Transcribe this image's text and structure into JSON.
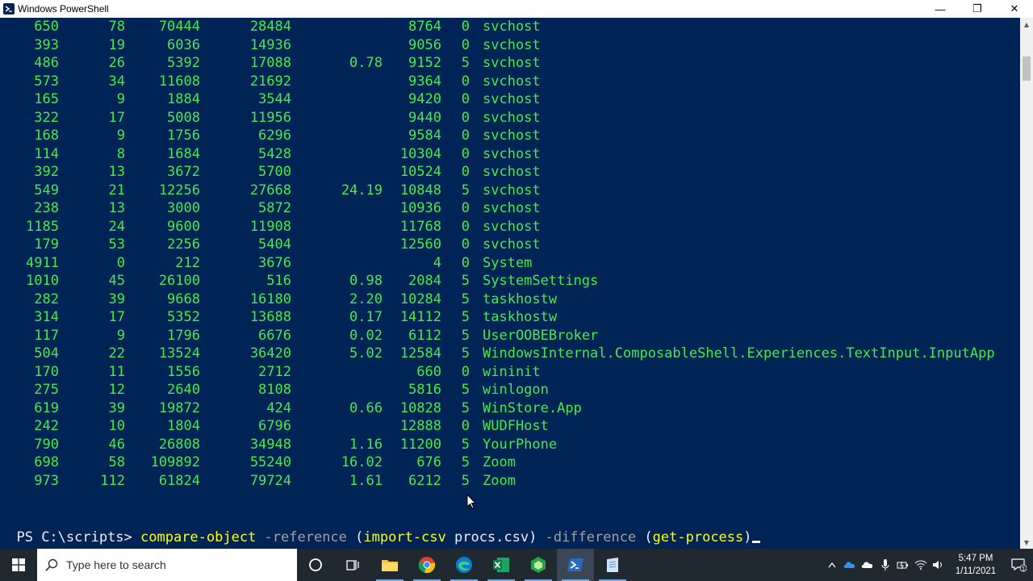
{
  "window": {
    "title": "Windows PowerShell",
    "minimize_glyph": "—",
    "restore_glyph": "❐",
    "close_glyph": "✕"
  },
  "colors": {
    "console_bg": "#012456",
    "output_text": "#4be84b",
    "command_text": "#ffff00",
    "parameter_text": "#a0a0a0",
    "prompt_text": "#eeedf0"
  },
  "process_rows": [
    [
      "650",
      "78",
      "70444",
      "28484",
      "",
      "8764",
      "0",
      "svchost"
    ],
    [
      "393",
      "19",
      "6036",
      "14936",
      "",
      "9056",
      "0",
      "svchost"
    ],
    [
      "486",
      "26",
      "5392",
      "17088",
      "0.78",
      "9152",
      "5",
      "svchost"
    ],
    [
      "573",
      "34",
      "11608",
      "21692",
      "",
      "9364",
      "0",
      "svchost"
    ],
    [
      "165",
      "9",
      "1884",
      "3544",
      "",
      "9420",
      "0",
      "svchost"
    ],
    [
      "322",
      "17",
      "5008",
      "11956",
      "",
      "9440",
      "0",
      "svchost"
    ],
    [
      "168",
      "9",
      "1756",
      "6296",
      "",
      "9584",
      "0",
      "svchost"
    ],
    [
      "114",
      "8",
      "1684",
      "5428",
      "",
      "10304",
      "0",
      "svchost"
    ],
    [
      "392",
      "13",
      "3672",
      "5700",
      "",
      "10524",
      "0",
      "svchost"
    ],
    [
      "549",
      "21",
      "12256",
      "27668",
      "24.19",
      "10848",
      "5",
      "svchost"
    ],
    [
      "238",
      "13",
      "3000",
      "5872",
      "",
      "10936",
      "0",
      "svchost"
    ],
    [
      "1185",
      "24",
      "9600",
      "11908",
      "",
      "11768",
      "0",
      "svchost"
    ],
    [
      "179",
      "53",
      "2256",
      "5404",
      "",
      "12560",
      "0",
      "svchost"
    ],
    [
      "4911",
      "0",
      "212",
      "3676",
      "",
      "4",
      "0",
      "System"
    ],
    [
      "1010",
      "45",
      "26100",
      "516",
      "0.98",
      "2084",
      "5",
      "SystemSettings"
    ],
    [
      "282",
      "39",
      "9668",
      "16180",
      "2.20",
      "10284",
      "5",
      "taskhostw"
    ],
    [
      "314",
      "17",
      "5352",
      "13688",
      "0.17",
      "14112",
      "5",
      "taskhostw"
    ],
    [
      "117",
      "9",
      "1796",
      "6676",
      "0.02",
      "6112",
      "5",
      "UserOOBEBroker"
    ],
    [
      "504",
      "22",
      "13524",
      "36420",
      "5.02",
      "12584",
      "5",
      "WindowsInternal.ComposableShell.Experiences.TextInput.InputApp"
    ],
    [
      "170",
      "11",
      "1556",
      "2712",
      "",
      "660",
      "0",
      "wininit"
    ],
    [
      "275",
      "12",
      "2640",
      "8108",
      "",
      "5816",
      "5",
      "winlogon"
    ],
    [
      "619",
      "39",
      "19872",
      "424",
      "0.66",
      "10828",
      "5",
      "WinStore.App"
    ],
    [
      "242",
      "10",
      "1804",
      "6796",
      "",
      "12888",
      "0",
      "WUDFHost"
    ],
    [
      "790",
      "46",
      "26808",
      "34948",
      "1.16",
      "11200",
      "5",
      "YourPhone"
    ],
    [
      "698",
      "58",
      "109892",
      "55240",
      "16.02",
      "676",
      "5",
      "Zoom"
    ],
    [
      "973",
      "112",
      "61824",
      "79724",
      "1.61",
      "6212",
      "5",
      "Zoom"
    ]
  ],
  "prompt": {
    "path": "PS C:\\scripts> ",
    "cmd": "compare-object",
    "param1": " -reference ",
    "open1": "(",
    "cmd2": "import-csv",
    "arg1": " procs.csv",
    "close1": ")",
    "param2": " -difference ",
    "open2": "(",
    "cmd3": "get-process",
    "close2": ")"
  },
  "taskbar": {
    "search_placeholder": "Type here to search",
    "pinned_icons": [
      "start-icon",
      "cortana-icon",
      "task-view-icon",
      "file-explorer-icon",
      "chrome-icon",
      "edge-icon",
      "excel-icon",
      "cube-app-icon",
      "powershell-icon",
      "notepad-icon"
    ],
    "time": "5:47 PM",
    "date": "1/11/2021",
    "notification_count": "1"
  }
}
